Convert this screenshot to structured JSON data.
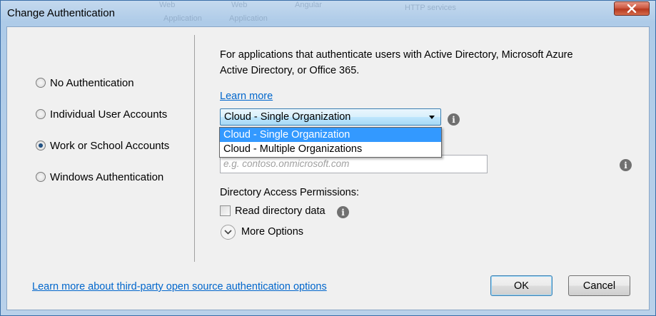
{
  "window": {
    "title": "Change Authentication",
    "background_ghost_labels": [
      "Web",
      "Web",
      "Angular",
      "Application",
      "Application",
      "HTTP services"
    ]
  },
  "auth_options": [
    {
      "label": "No Authentication",
      "checked": false
    },
    {
      "label": "Individual User Accounts",
      "checked": false
    },
    {
      "label": "Work or School Accounts",
      "checked": true
    },
    {
      "label": "Windows Authentication",
      "checked": false
    }
  ],
  "panel": {
    "description": "For applications that authenticate users with Active Directory, Microsoft Azure Active Directory, or Office 365.",
    "learn_more": "Learn more",
    "org_select": {
      "value": "Cloud - Single Organization",
      "options": [
        "Cloud - Single Organization",
        "Cloud - Multiple Organizations"
      ],
      "highlighted": "Cloud - Single Organization"
    },
    "domain_placeholder": "e.g. contoso.onmicrosoft.com",
    "permissions_label": "Directory Access Permissions:",
    "read_directory_label": "Read directory data",
    "read_directory_checked": false,
    "more_options_label": "More Options"
  },
  "footer": {
    "third_party_link": "Learn more about third-party open source authentication options",
    "ok_label": "OK",
    "cancel_label": "Cancel"
  },
  "icons": {
    "info": "info-icon",
    "close": "close-icon",
    "chevron": "chevron-down-icon",
    "dropdown_arrow": "dropdown-arrow-icon"
  },
  "colors": {
    "link": "#0066cc",
    "selection": "#3399ff",
    "close_button": "#c7432a",
    "title_bar": "#b9d1ea"
  }
}
